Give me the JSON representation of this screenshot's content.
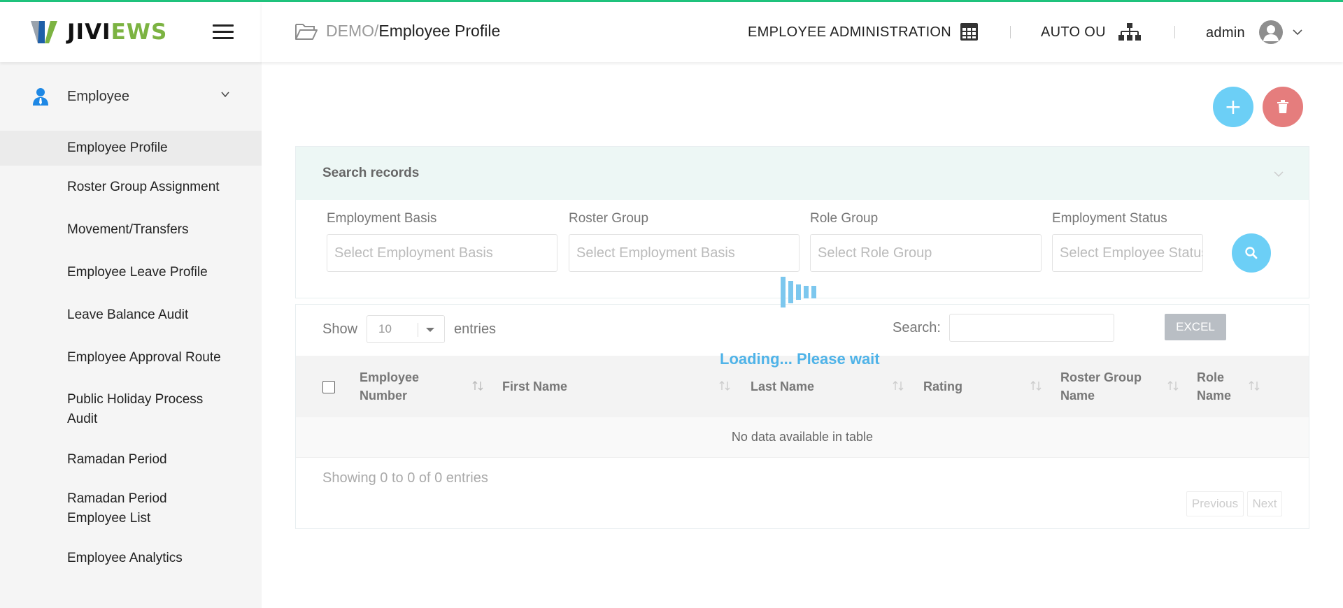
{
  "app": {
    "brand_part1": "JIVI",
    "brand_part2": "EWS",
    "accent_color": "#1fc37d"
  },
  "sidebar": {
    "group": {
      "label": "Employee",
      "icon": "person-icon"
    },
    "items": [
      {
        "label": "Employee Profile",
        "active": true
      },
      {
        "label": "Roster Group Assignment"
      },
      {
        "label": "Movement/Transfers"
      },
      {
        "label": "Employee Leave Profile"
      },
      {
        "label": "Leave Balance Audit"
      },
      {
        "label": "Employee Approval Route"
      },
      {
        "label": "Public Holiday Process Audit"
      },
      {
        "label": "Ramadan Period"
      },
      {
        "label": "Ramadan Period Employee List"
      },
      {
        "label": "Employee Analytics"
      }
    ]
  },
  "header": {
    "breadcrumb_root": "DEMO",
    "breadcrumb_sep": "/",
    "breadcrumb_page": "Employee Profile",
    "module": "EMPLOYEE ADMINISTRATION",
    "org_unit": "AUTO OU",
    "user": "admin"
  },
  "search": {
    "title": "Search records",
    "filters": [
      {
        "label": "Employment Basis",
        "placeholder": "Select Employment Basis"
      },
      {
        "label": "Roster Group",
        "placeholder": "Select Employment Basis"
      },
      {
        "label": "Role Group",
        "placeholder": "Select Role Group"
      },
      {
        "label": "Employment Status",
        "placeholder": "Select Employee Status"
      }
    ]
  },
  "table": {
    "show_label": "Show",
    "page_length": "10",
    "entries_label": "entries",
    "search_label": "Search:",
    "excel_label": "EXCEL",
    "loading_text": "Loading... Please wait",
    "columns": [
      {
        "line1": "Employee",
        "line2": "Number"
      },
      {
        "line1": "First Name",
        "line2": ""
      },
      {
        "line1": "Last Name",
        "line2": ""
      },
      {
        "line1": "Rating",
        "line2": ""
      },
      {
        "line1": "Roster Group",
        "line2": "Name"
      },
      {
        "line1": "Role",
        "line2": "Name"
      }
    ],
    "empty_message": "No data available in table",
    "info": "Showing 0 to 0 of 0 entries",
    "prev_label": "Previous",
    "next_label": "Next"
  }
}
